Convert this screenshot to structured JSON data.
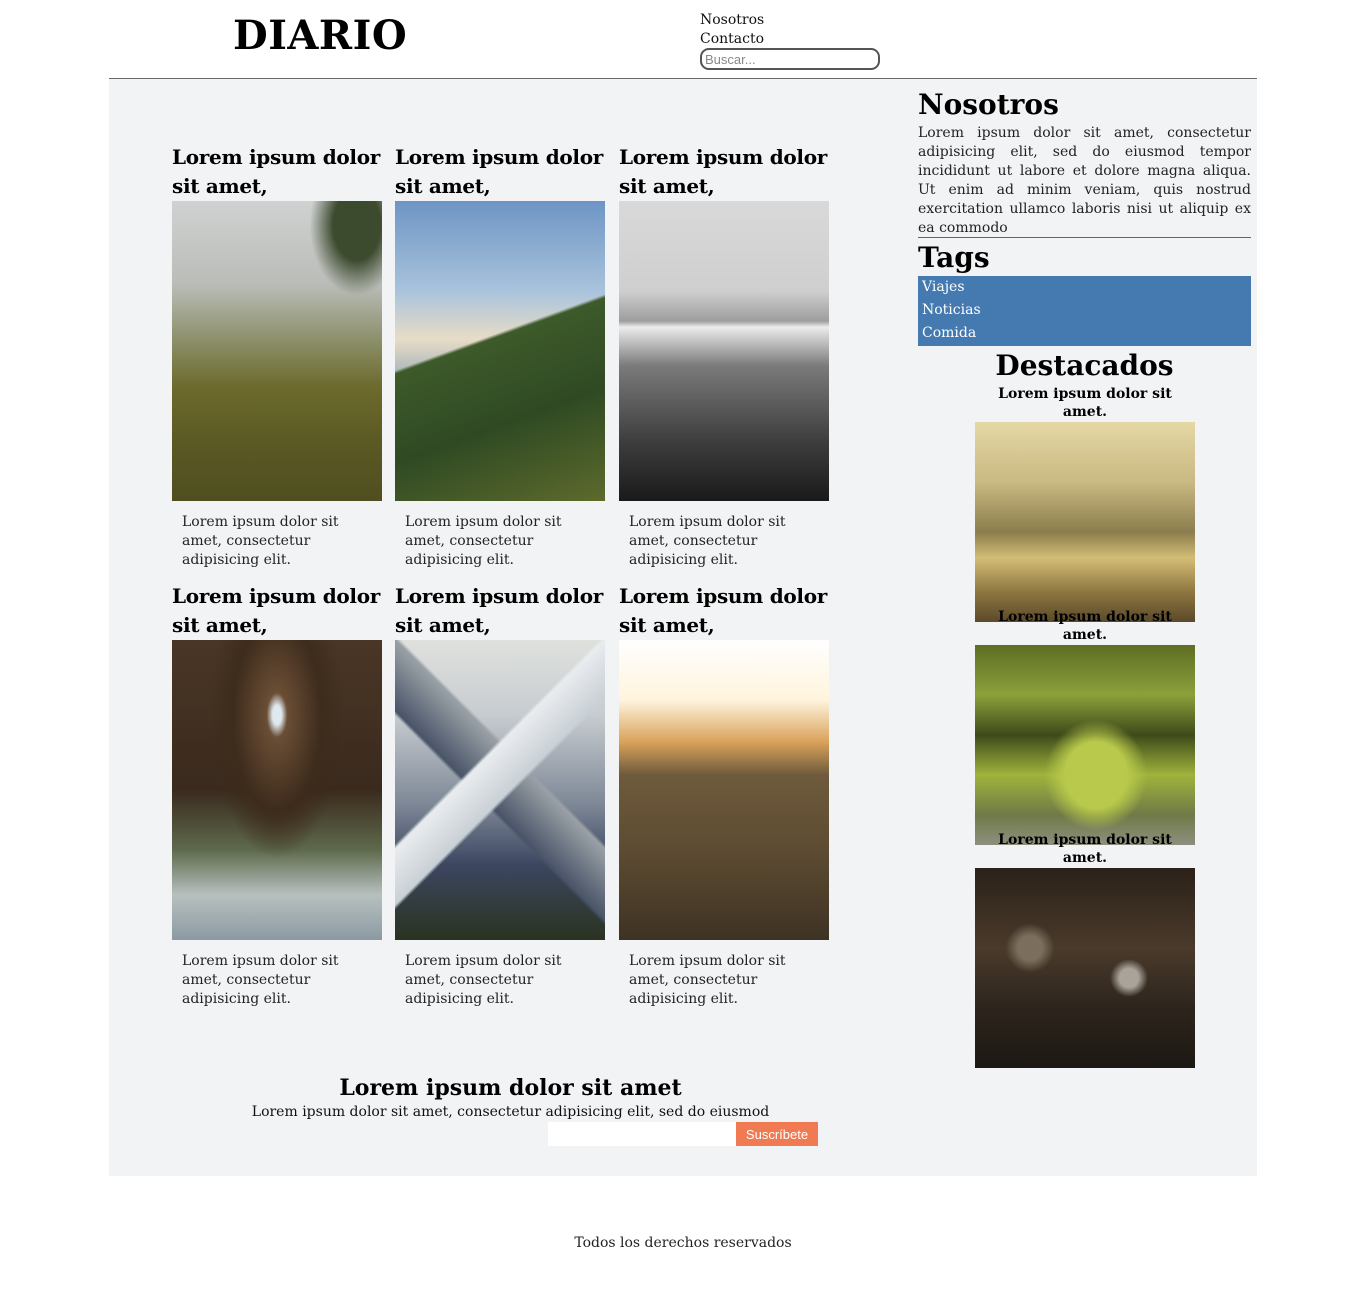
{
  "header": {
    "logo": "DIARIO",
    "nav": [
      "Nosotros",
      "Contacto"
    ],
    "search_placeholder": "Buscar..."
  },
  "posts": [
    {
      "title": "Lorem ipsum dolor sit amet,",
      "text": "Lorem ipsum dolor sit amet, consectetur adipisicing elit."
    },
    {
      "title": "Lorem ipsum dolor sit amet,",
      "text": "Lorem ipsum dolor sit amet, consectetur adipisicing elit."
    },
    {
      "title": "Lorem ipsum dolor sit amet,",
      "text": "Lorem ipsum dolor sit amet, consectetur adipisicing elit."
    },
    {
      "title": "Lorem ipsum dolor sit amet,",
      "text": "Lorem ipsum dolor sit amet, consectetur adipisicing elit."
    },
    {
      "title": "Lorem ipsum dolor sit amet,",
      "text": "Lorem ipsum dolor sit amet, consectetur adipisicing elit."
    },
    {
      "title": "Lorem ipsum dolor sit amet,",
      "text": "Lorem ipsum dolor sit amet, consectetur adipisicing elit."
    }
  ],
  "sidebar": {
    "about_title": "Nosotros",
    "about_text": "Lorem ipsum dolor sit amet, consectetur adipisicing elit, sed do eiusmod tempor incididunt ut labore et dolore magna aliqua. Ut enim ad minim veniam, quis nostrud exercitation ullamco laboris nisi ut aliquip ex ea commodo",
    "tags_title": "Tags",
    "tags": [
      "Viajes",
      "Noticias",
      "Comida"
    ],
    "tags_color": "#447ab0",
    "featured_title": "Destacados",
    "featured": [
      {
        "title": "Lorem ipsum dolor sit amet."
      },
      {
        "title": "Lorem ipsum dolor sit amet."
      },
      {
        "title": "Lorem ipsum dolor sit amet."
      }
    ]
  },
  "newsletter": {
    "title": "Lorem ipsum dolor sit amet",
    "text": "Lorem ipsum dolor sit amet, consectetur adipisicing elit, sed do eiusmod",
    "email_value": "",
    "button_label": "Suscríbete",
    "button_color": "#f07a52"
  },
  "footer": {
    "text": "Todos los derechos reservados"
  }
}
